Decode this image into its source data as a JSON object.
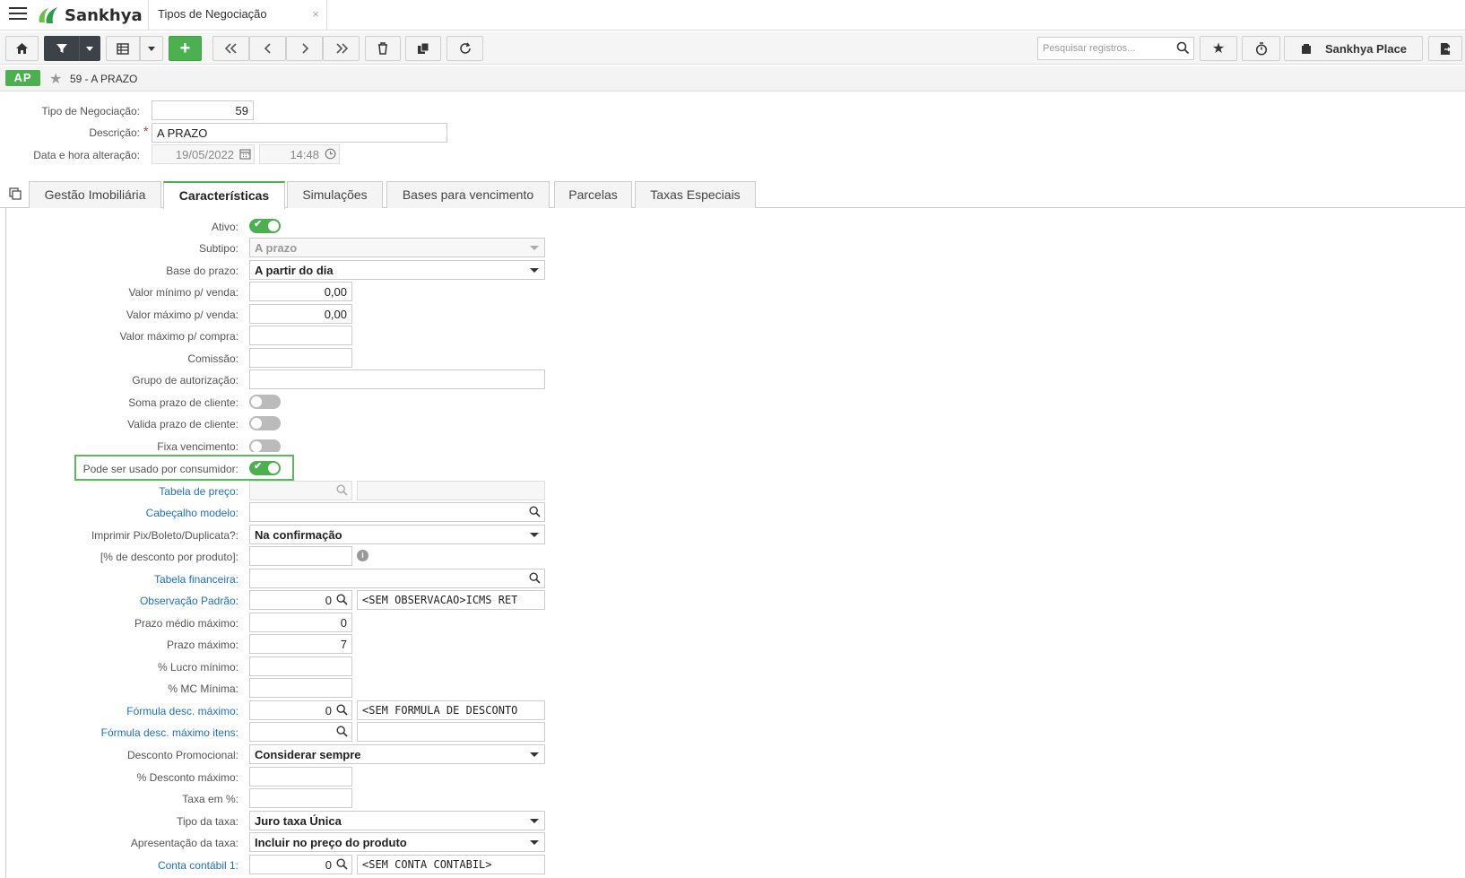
{
  "app": {
    "brand": "Sankhya",
    "tab_title": "Tipos de Negociação",
    "close_label": "×"
  },
  "toolbar": {
    "search_placeholder": "Pesquisar registros...",
    "place_label": "Sankhya Place"
  },
  "record": {
    "badge": "AP",
    "title": "59 - A PRAZO"
  },
  "header": {
    "tipo_label": "Tipo de Negociação:",
    "tipo_value": "59",
    "descricao_label": "Descrição:",
    "descricao_value": "A PRAZO",
    "data_label": "Data e hora alteração:",
    "data_value": "19/05/2022",
    "hora_value": "14:48"
  },
  "tabs": [
    "Gestão Imobiliária",
    "Características",
    "Simulações",
    "Bases para vencimento",
    "Parcelas",
    "Taxas Especiais"
  ],
  "form": {
    "ativo": "Ativo:",
    "subtipo": "Subtipo:",
    "subtipo_value": "A prazo",
    "base_prazo": "Base do prazo:",
    "base_prazo_value": "A partir do dia",
    "valor_min_venda": "Valor mínimo p/ venda:",
    "valor_min_venda_value": "0,00",
    "valor_max_venda": "Valor máximo p/ venda:",
    "valor_max_venda_value": "0,00",
    "valor_max_compra": "Valor máximo p/ compra:",
    "comissao": "Comissão:",
    "grupo_autorizacao": "Grupo de autorização:",
    "soma_prazo": "Soma prazo de cliente:",
    "valida_prazo": "Valida prazo de cliente:",
    "fixa_vencimento": "Fixa vencimento:",
    "consumidor": "Pode ser usado por consumidor:",
    "tabela_preco": "Tabela de preço:",
    "cabecalho_modelo": "Cabeçalho modelo:",
    "imprimir_pix": "Imprimir Pix/Boleto/Duplicata?:",
    "imprimir_pix_value": "Na confirmação",
    "desc_produto": "[% de desconto por produto]:",
    "tabela_financeira": "Tabela financeira:",
    "obs_padrao": "Observação Padrão:",
    "obs_padrao_code": "0",
    "obs_padrao_desc": "<SEM OBSERVACAO>ICMS RET",
    "prazo_medio_max": "Prazo médio máximo:",
    "prazo_medio_max_value": "0",
    "prazo_max": "Prazo máximo:",
    "prazo_max_value": "7",
    "lucro_min": "% Lucro mínimo:",
    "mc_min": "% MC Mínima:",
    "formula_desc": "Fórmula desc. máximo:",
    "formula_desc_code": "0",
    "formula_desc_desc": "<SEM FORMULA DE DESCONTO",
    "formula_desc_itens": "Fórmula desc. máximo itens:",
    "desconto_promo": "Desconto Promocional:",
    "desconto_promo_value": "Considerar sempre",
    "desconto_max": "% Desconto máximo:",
    "taxa": "Taxa em %:",
    "tipo_taxa": "Tipo da taxa:",
    "tipo_taxa_value": "Juro taxa Única",
    "apresentacao_taxa": "Apresentação da taxa:",
    "apresentacao_taxa_value": "Incluir no preço do produto",
    "conta_contabil": "Conta contábil 1:",
    "conta_contabil_code": "0",
    "conta_contabil_desc": "<SEM CONTA CONTABIL>"
  },
  "colors": {
    "accent": "#4caf50",
    "link": "#1e6fc2"
  }
}
